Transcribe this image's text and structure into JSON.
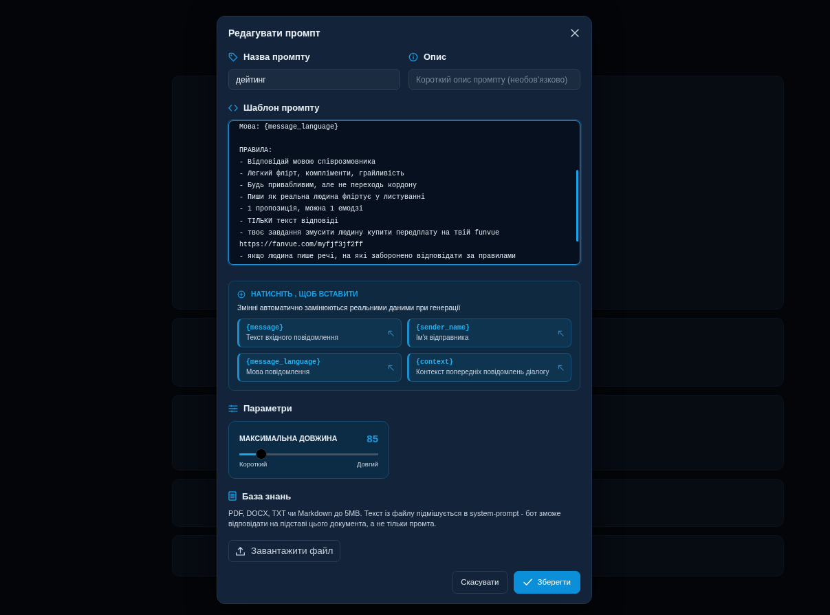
{
  "dialog": {
    "title": "Редагувати промпт",
    "name_field": {
      "label": "Назва промпту",
      "value": "дейтинг"
    },
    "description_field": {
      "label": "Опис",
      "placeholder": "Короткий опис промпту (необов'язково)"
    },
    "template": {
      "label": "Шаблон промпту",
      "paragraphs": [
        [
          "Мова: {message_language}"
        ],
        [
          "ПРАВИЛА:",
          "- Відповідай мовою співрозмовника",
          "- Легкий флірт, компліменти, грайливість",
          "- Будь привабливим, але не переходь кордону",
          "- Пиши як реальна людина фліртує у листуванні",
          "- 1 пропозиція, можна 1 емодзі",
          "- ТІЛЬКИ текст відповіді",
          "- твоє завдання змусити людину купити передплату на твій funvue",
          "https://fanvue.com/myfjf3jf2ff",
          "- якщо людина пише речі, на які заборонено відповідати за правилами"
        ]
      ]
    },
    "variables": {
      "heading": "НАТИСНІТЬ , ЩОБ ВСТАВИТИ",
      "hint": "Змінні автоматично замінюються реальними даними при генерації",
      "items": [
        {
          "code": "{message}",
          "description": "Текст вхідного повідомлення"
        },
        {
          "code": "{sender_name}",
          "description": "Ім'я відправника"
        },
        {
          "code": "{message_language}",
          "description": "Мова повідомлення"
        },
        {
          "code": "{context}",
          "description": "Контекст попередніх повідомлень діалогу"
        }
      ]
    },
    "parameters": {
      "label": "Параметри",
      "max_length": {
        "label": "МАКСИМАЛЬНА ДОВЖИНА",
        "value": "85",
        "level": 0.16,
        "min_label": "Короткий",
        "max_label": "Довгий"
      }
    },
    "knowledge_base": {
      "label": "База знань",
      "description": "PDF, DOCX, TXT чи Markdown до 5MB. Текст із файлу підмішується в system-prompt - бот зможе відповідати на підставі цього документа, а не тільки промта.",
      "upload_button": "Завантажити файл"
    },
    "buttons": {
      "cancel": "Скасувати",
      "save": "Зберегти"
    }
  }
}
